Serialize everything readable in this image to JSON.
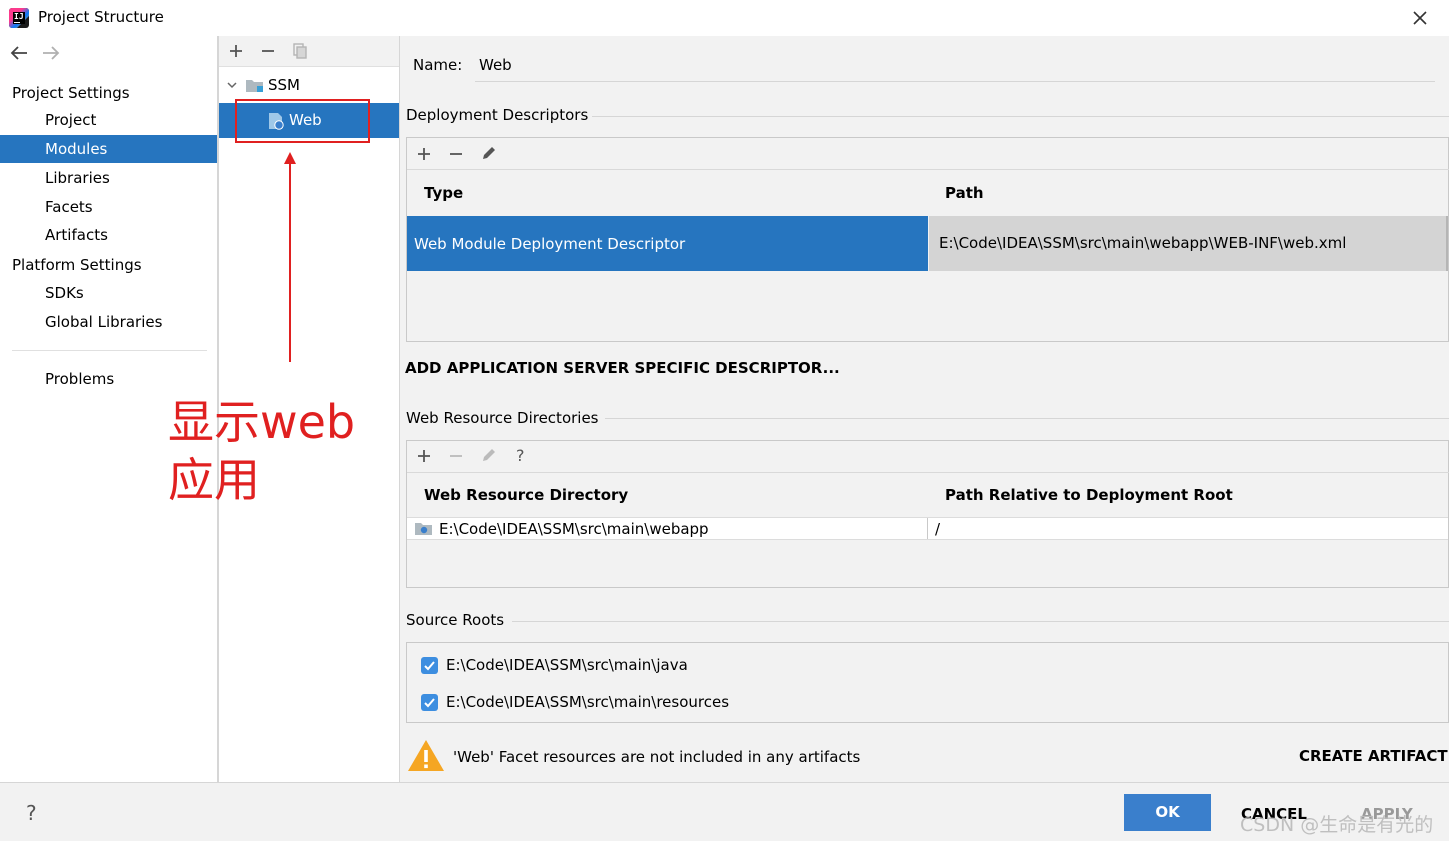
{
  "window": {
    "title": "Project Structure"
  },
  "nav": {
    "project_settings_header": "Project Settings",
    "items_project": [
      "Project",
      "Modules",
      "Libraries",
      "Facets",
      "Artifacts"
    ],
    "platform_settings_header": "Platform Settings",
    "items_platform": [
      "SDKs",
      "Global Libraries"
    ],
    "problems": "Problems",
    "selected": "Modules"
  },
  "tree": {
    "root": "SSM",
    "child": "Web"
  },
  "annotation": {
    "line1": "显示web",
    "line2": "应用",
    "color": "#e02020"
  },
  "main": {
    "name_label": "Name:",
    "name_value": "Web",
    "deployment": {
      "title": "Deployment Descriptors",
      "col_type": "Type",
      "col_path": "Path",
      "row_type": "Web Module Deployment Descriptor",
      "row_path": "E:\\Code\\IDEA\\SSM\\src\\main\\webapp\\WEB-INF\\web.xml"
    },
    "add_server_descriptor": "ADD APPLICATION SERVER SPECIFIC DESCRIPTOR...",
    "web_resources": {
      "title": "Web Resource Directories",
      "col_dir": "Web Resource Directory",
      "col_rel": "Path Relative to Deployment Root",
      "row_dir": "E:\\Code\\IDEA\\SSM\\src\\main\\webapp",
      "row_rel": "/"
    },
    "source_roots": {
      "title": "Source Roots",
      "items": [
        "E:\\Code\\IDEA\\SSM\\src\\main\\java",
        "E:\\Code\\IDEA\\SSM\\src\\main\\resources"
      ]
    },
    "warning_text": "'Web' Facet resources are not included in any artifacts",
    "create_artifact": "CREATE ARTIFACT"
  },
  "footer": {
    "help": "?",
    "ok": "OK",
    "cancel": "CANCEL",
    "apply": "APPLY",
    "watermark": "CSDN @生命是有光的"
  },
  "colors": {
    "accent": "#2675bf",
    "ok_button": "#3a7fcc",
    "warning": "#f5a623"
  }
}
